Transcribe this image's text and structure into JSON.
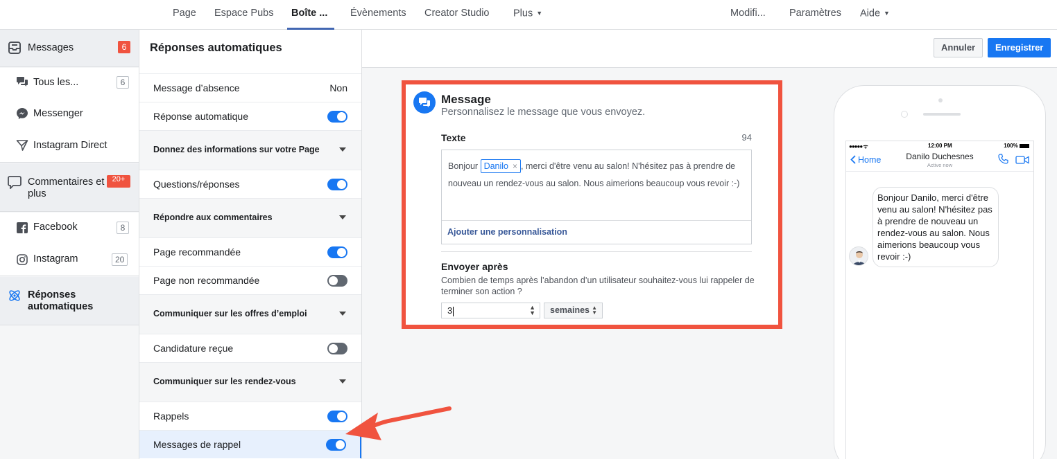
{
  "topnav": {
    "tabs": [
      {
        "label": "Page"
      },
      {
        "label": "Espace Pubs"
      },
      {
        "label": "Boîte ..."
      },
      {
        "label": "Évènements"
      },
      {
        "label": "Creator Studio"
      },
      {
        "label": "Plus"
      }
    ],
    "right": [
      {
        "label": "Modifi..."
      },
      {
        "label": "Paramètres"
      },
      {
        "label": "Aide"
      }
    ]
  },
  "sidebar": {
    "messages": {
      "label": "Messages",
      "badge": "6"
    },
    "tous": {
      "label": "Tous les...",
      "badge": "6"
    },
    "messenger": {
      "label": "Messenger"
    },
    "instagram_direct": {
      "label": "Instagram Direct"
    },
    "commentaires": {
      "label": "Commentaires et plus",
      "badge": "20+"
    },
    "facebook": {
      "label": "Facebook",
      "badge": "8"
    },
    "instagram": {
      "label": "Instagram",
      "badge": "20"
    },
    "reponses": {
      "label": "Réponses automatiques"
    }
  },
  "panel": {
    "title": "Réponses automatiques",
    "absence": {
      "label": "Message d’absence",
      "value": "Non"
    },
    "auto": {
      "label": "Réponse automatique",
      "toggle": "on"
    },
    "sec_infos": "Donnez des informations sur votre Page",
    "qr": {
      "label": "Questions/réponses",
      "toggle": "on"
    },
    "sec_comments": "Répondre aux commentaires",
    "reco": {
      "label": "Page recommandée",
      "toggle": "on"
    },
    "nonreco": {
      "label": "Page non recommandée",
      "toggle": "off"
    },
    "sec_jobs": "Communiquer sur les offres d’emploi",
    "candidature": {
      "label": "Candidature reçue",
      "toggle": "off"
    },
    "sec_rdv": "Communiquer sur les rendez-vous",
    "rappels": {
      "label": "Rappels",
      "toggle": "on"
    },
    "messages_rappel": {
      "label": "Messages de rappel",
      "toggle": "on"
    }
  },
  "actions": {
    "cancel": "Annuler",
    "save": "Enregistrer"
  },
  "editor": {
    "title": "Message",
    "subtitle": "Personnalisez le message que vous envoyez.",
    "text_label": "Texte",
    "char_count": "94",
    "text_before": "Bonjour ",
    "token": "Danilo",
    "token_remove": "×",
    "text_after": ", merci d'être venu au salon! N'hésitez pas à prendre de nouveau un rendez-vous au salon. Nous aimerions beaucoup vous revoir :-)",
    "add_personalization": "Ajouter une personnalisation",
    "send_after_label": "Envoyer après",
    "send_after_desc": "Combien de temps après l’abandon d’un utilisateur souhaitez-vous lui rappeler de terminer son action ?",
    "amount": "3",
    "unit": "semaines"
  },
  "preview": {
    "signal": "●●●●● ᯤ",
    "time": "12:00 PM",
    "battery": "100%",
    "back": "Home",
    "name": "Danilo Duchesnes",
    "status": "Active now",
    "bubble": "Bonjour Danilo, merci d'être venu au salon! N'hésitez pas à prendre de nouveau un rendez-vous au salon. Nous aimerions beaucoup vous revoir :-)"
  },
  "colors": {
    "accent": "#1877f2",
    "highlight": "#f0533f",
    "badge_red": "#f0533f"
  }
}
